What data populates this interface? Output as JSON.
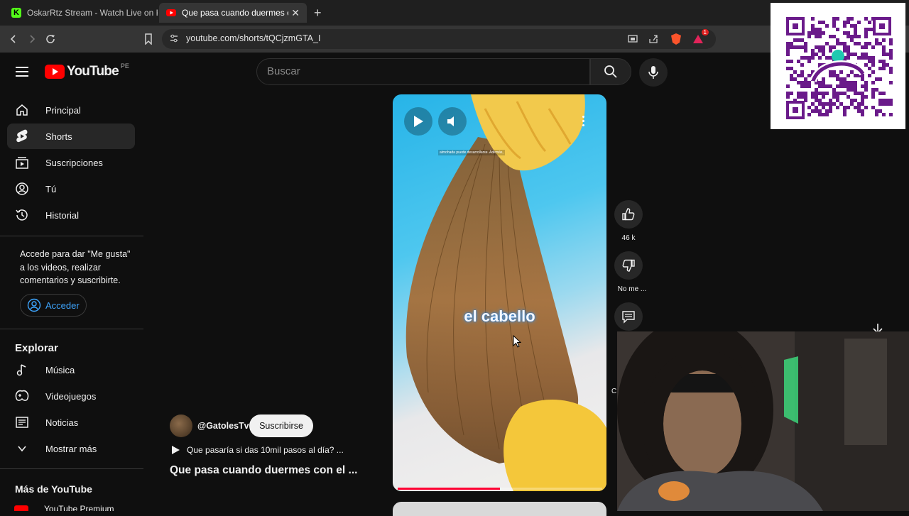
{
  "browser": {
    "tabs": [
      {
        "title": "OskarRtz Stream - Watch Live on Kick",
        "active": false,
        "favicon": "kick-icon",
        "color": "#53fc18"
      },
      {
        "title": "Que pasa cuando duermes con el",
        "active": true,
        "favicon": "youtube-icon",
        "color": "#ff0000"
      }
    ],
    "url": "youtube.com/shorts/tQCjzmGTA_I",
    "badge": "1"
  },
  "youtube": {
    "logo_text": "YouTube",
    "region": "PE",
    "search_placeholder": "Buscar",
    "sidebar": {
      "main": [
        {
          "label": "Principal",
          "icon": "home-icon"
        },
        {
          "label": "Shorts",
          "icon": "shorts-icon"
        },
        {
          "label": "Suscripciones",
          "icon": "subscriptions-icon"
        },
        {
          "label": "Tú",
          "icon": "user-icon"
        },
        {
          "label": "Historial",
          "icon": "history-icon"
        }
      ],
      "signin_prompt": "Accede para dar \"Me gusta\" a los videos, realizar comentarios y suscribirte.",
      "signin_button": "Acceder",
      "explore_header": "Explorar",
      "explore": [
        {
          "label": "Música",
          "icon": "music-icon"
        },
        {
          "label": "Videojuegos",
          "icon": "gaming-icon"
        },
        {
          "label": "Noticias",
          "icon": "news-icon"
        },
        {
          "label": "Mostrar más",
          "icon": "chevron-down-icon"
        }
      ],
      "more_header": "Más de YouTube",
      "more_partial": "YouTube Premium"
    },
    "short": {
      "channel": "@GatolesTv",
      "subscribe": "Suscribirse",
      "playlist_title": "Que pasaría si das 10mil pasos al día? ...",
      "title": "Que pasa cuando duermes con el ...",
      "caption": "el cabello",
      "tiny_caption": "almohada puede desarrollarse. Además,",
      "progress": 0.5
    },
    "actions": {
      "likes": "46 k",
      "dislike": "No me ...",
      "comments_partial": "C"
    }
  }
}
